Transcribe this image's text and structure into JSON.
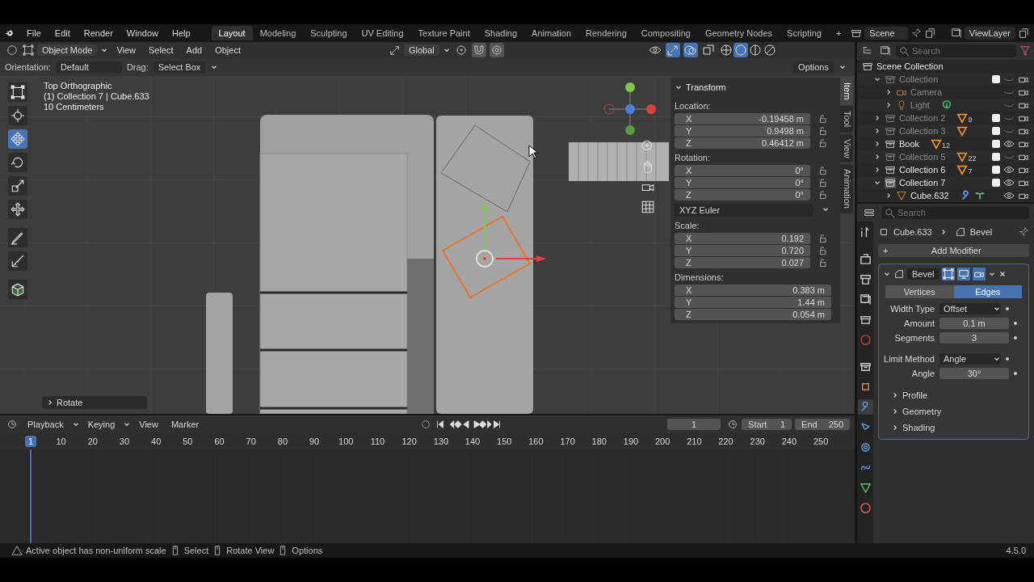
{
  "menu": [
    "File",
    "Edit",
    "Render",
    "Window",
    "Help"
  ],
  "workspaces": [
    {
      "label": "Layout",
      "selected": true
    },
    {
      "label": "Modeling",
      "selected": false
    },
    {
      "label": "Sculpting",
      "selected": false
    },
    {
      "label": "UV Editing",
      "selected": false
    },
    {
      "label": "Texture Paint",
      "selected": false
    },
    {
      "label": "Shading",
      "selected": false
    },
    {
      "label": "Animation",
      "selected": false
    },
    {
      "label": "Rendering",
      "selected": false
    },
    {
      "label": "Compositing",
      "selected": false
    },
    {
      "label": "Geometry Nodes",
      "selected": false
    },
    {
      "label": "Scripting",
      "selected": false
    }
  ],
  "add_workspace": "+",
  "scene": "Scene",
  "view_layer": "ViewLayer",
  "viewport": {
    "mode": "Object Mode",
    "menus": [
      "View",
      "Select",
      "Add",
      "Object"
    ],
    "transform_orientation": "Global",
    "transform_toggles": [
      {
        "kind": "pivot",
        "on": false
      },
      {
        "kind": "snap",
        "on": true
      },
      {
        "kind": "proportional",
        "on": true
      }
    ],
    "header_toggles": [
      {
        "kind": "visibility",
        "on": false
      },
      {
        "kind": "gizmo",
        "on": true
      },
      {
        "kind": "overlay",
        "on": true
      },
      {
        "kind": "xray",
        "on": false
      }
    ],
    "shading": [
      {
        "kind": "wireframe",
        "selected": false
      },
      {
        "kind": "solid",
        "selected": true
      },
      {
        "kind": "material",
        "selected": false
      },
      {
        "kind": "rendered",
        "selected": false
      }
    ],
    "tool_settings": {
      "orientation_label": "Orientation:",
      "orientation": "Default",
      "drag_label": "Drag:",
      "drag": "Select Box",
      "options": "Options"
    },
    "overlay_text": [
      "Top Orthographic",
      "(1) Collection 7 | Cube.633",
      "10 Centimeters"
    ],
    "tools": [
      {
        "kind": "select",
        "selected": false
      },
      {
        "kind": "cursor",
        "selected": false
      },
      {
        "kind": "move",
        "selected": true
      },
      {
        "kind": "rotate",
        "selected": false
      },
      {
        "kind": "scale",
        "selected": false
      },
      {
        "kind": "transform",
        "selected": false
      },
      {
        "kind": "annotate",
        "selected": false
      },
      {
        "kind": "measure",
        "selected": false
      },
      {
        "kind": "add_cube",
        "selected": false
      }
    ],
    "last_operator": "Rotate",
    "n_panel": {
      "title": "Transform",
      "tabs": [
        {
          "label": "Item",
          "selected": true
        },
        {
          "label": "Tool",
          "selected": false
        },
        {
          "label": "View",
          "selected": false
        },
        {
          "label": "Animation",
          "selected": false
        }
      ],
      "sections": [
        {
          "label": "Location:",
          "locks": true,
          "rows": [
            {
              "axis": "X",
              "value": "-0.19458 m"
            },
            {
              "axis": "Y",
              "value": "0.9498 m"
            },
            {
              "axis": "Z",
              "value": "0.46412 m"
            }
          ]
        },
        {
          "label": "Rotation:",
          "locks": true,
          "mode": "XYZ Euler",
          "rows": [
            {
              "axis": "X",
              "value": "0°"
            },
            {
              "axis": "Y",
              "value": "0°"
            },
            {
              "axis": "Z",
              "value": "0°"
            }
          ]
        },
        {
          "label": "Scale:",
          "locks": true,
          "rows": [
            {
              "axis": "X",
              "value": "0.192"
            },
            {
              "axis": "Y",
              "value": "0.720"
            },
            {
              "axis": "Z",
              "value": "0.027"
            }
          ]
        },
        {
          "label": "Dimensions:",
          "locks": false,
          "rows": [
            {
              "axis": "X",
              "value": "0.383 m"
            },
            {
              "axis": "Y",
              "value": "1.44 m"
            },
            {
              "axis": "Z",
              "value": "0.054 m"
            }
          ]
        }
      ]
    }
  },
  "outliner": {
    "search_placeholder": "Search",
    "items": [
      {
        "name": "Scene Collection",
        "kind": "scene",
        "dimmed": false,
        "children": [
          {
            "name": "Collection",
            "kind": "collection",
            "dimmed": true,
            "expanded": true,
            "checked": true,
            "visible": false,
            "children": [
              {
                "name": "Camera",
                "kind": "camera",
                "dimmed": true,
                "expanded": false,
                "visible": false
              },
              {
                "name": "Light",
                "kind": "light",
                "dimmed": true,
                "expanded": false,
                "visible": false,
                "badges": [
                  {
                    "kind": "light_data"
                  }
                ]
              }
            ]
          },
          {
            "name": "Collection 2",
            "kind": "collection",
            "dimmed": true,
            "expanded": false,
            "checked": true,
            "visible": false,
            "badges": [
              {
                "kind": "mesh",
                "count": "9"
              }
            ]
          },
          {
            "name": "Collection 3",
            "kind": "collection",
            "dimmed": true,
            "expanded": false,
            "checked": true,
            "visible": false,
            "badges": [
              {
                "kind": "mesh"
              }
            ]
          },
          {
            "name": "Book",
            "kind": "collection",
            "dimmed": false,
            "expanded": false,
            "checked": true,
            "visible": true,
            "badges": [
              {
                "kind": "mesh",
                "count": "12"
              }
            ]
          },
          {
            "name": "Collection 5",
            "kind": "collection",
            "dimmed": true,
            "expanded": false,
            "checked": true,
            "visible": false,
            "badges": [
              {
                "kind": "mesh",
                "count": "22"
              }
            ]
          },
          {
            "name": "Collection 6",
            "kind": "collection",
            "dimmed": false,
            "expanded": false,
            "checked": true,
            "visible": true,
            "badges": [
              {
                "kind": "mesh",
                "count": "7"
              }
            ]
          },
          {
            "name": "Collection 7",
            "kind": "collection",
            "dimmed": false,
            "expanded": true,
            "active": true,
            "checked": true,
            "visible": true,
            "children": [
              {
                "name": "Cube.632",
                "kind": "mesh",
                "dimmed": false,
                "expanded": false,
                "visible": true,
                "badges": [
                  {
                    "kind": "modifier"
                  },
                  {
                    "kind": "mesh_data"
                  }
                ]
              }
            ]
          }
        ]
      }
    ]
  },
  "properties": {
    "search_placeholder": "Search",
    "tabs": [
      {
        "kind": "tool",
        "selected": false
      },
      {
        "kind": "render",
        "selected": false
      },
      {
        "kind": "output",
        "selected": false
      },
      {
        "kind": "view_layer",
        "selected": false
      },
      {
        "kind": "scene",
        "selected": false
      },
      {
        "kind": "world",
        "selected": false
      },
      {
        "kind": "collection",
        "selected": false
      },
      {
        "kind": "object",
        "selected": false
      },
      {
        "kind": "modifier",
        "selected": true
      },
      {
        "kind": "particles",
        "selected": false
      },
      {
        "kind": "physics",
        "selected": false
      },
      {
        "kind": "constraints",
        "selected": false
      },
      {
        "kind": "data",
        "selected": false
      },
      {
        "kind": "material",
        "selected": false
      }
    ],
    "object": "Cube.633",
    "modifier_name": "Bevel",
    "add_modifier_icon": "+",
    "add_modifier": "Add Modifier",
    "modifier": {
      "name": "Bevel",
      "expanded": true,
      "affect": [
        {
          "label": "Vertices",
          "selected": false
        },
        {
          "label": "Edges",
          "selected": true
        }
      ],
      "field_groups": [
        [
          {
            "label": "Width Type",
            "value": "Offset",
            "kind": "dropdown"
          },
          {
            "label": "Amount",
            "value": "0.1 m",
            "kind": "number"
          },
          {
            "label": "Segments",
            "value": "3",
            "kind": "number"
          }
        ],
        [
          {
            "label": "Limit Method",
            "value": "Angle",
            "kind": "dropdown"
          },
          {
            "label": "Angle",
            "value": "30°",
            "kind": "number"
          }
        ]
      ],
      "subpanels": [
        {
          "label": "Profile",
          "expanded": false
        },
        {
          "label": "Geometry",
          "expanded": false
        },
        {
          "label": "Shading",
          "expanded": false
        }
      ]
    }
  },
  "timeline": {
    "menus": [
      "Playback",
      "Keying",
      "View",
      "Marker"
    ],
    "current_frame": "1",
    "start_label": "Start",
    "start": "1",
    "end_label": "End",
    "end": "250",
    "ruler": [
      {
        "label": "1",
        "current": true
      },
      {
        "label": "10",
        "current": false
      },
      {
        "label": "20",
        "current": false
      },
      {
        "label": "30",
        "current": false
      },
      {
        "label": "40",
        "current": false
      },
      {
        "label": "50",
        "current": false
      },
      {
        "label": "60",
        "current": false
      },
      {
        "label": "70",
        "current": false
      },
      {
        "label": "80",
        "current": false
      },
      {
        "label": "90",
        "current": false
      },
      {
        "label": "100",
        "current": false
      },
      {
        "label": "110",
        "current": false
      },
      {
        "label": "120",
        "current": false
      },
      {
        "label": "130",
        "current": false
      },
      {
        "label": "140",
        "current": false
      },
      {
        "label": "150",
        "current": false
      },
      {
        "label": "160",
        "current": false
      },
      {
        "label": "170",
        "current": false
      },
      {
        "label": "180",
        "current": false
      },
      {
        "label": "190",
        "current": false
      },
      {
        "label": "200",
        "current": false
      },
      {
        "label": "210",
        "current": false
      },
      {
        "label": "220",
        "current": false
      },
      {
        "label": "230",
        "current": false
      },
      {
        "label": "240",
        "current": false
      },
      {
        "label": "250",
        "current": false
      }
    ]
  },
  "status": {
    "message": "Active object has non-uniform scale",
    "hints": [
      "Select",
      "Rotate View",
      "Options"
    ],
    "version": "4.5.0"
  }
}
